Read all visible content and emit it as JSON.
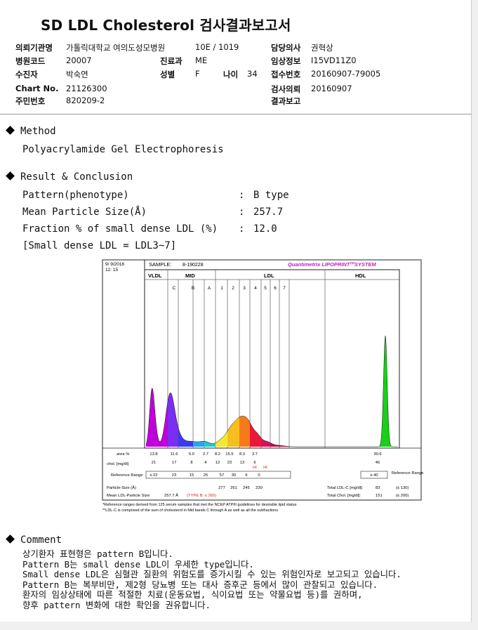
{
  "title": "SD LDL Cholesterol 검사결과보고서",
  "header": {
    "institution_label": "의뢰기관명",
    "institution_value": "가톨릭대학교 여의도성모병원",
    "ward_value": "10E / 1019",
    "doctor_label": "담당의사",
    "doctor_value": "권혁상",
    "hospital_code_label": "병원코드",
    "hospital_code_value": "20007",
    "dept_label": "진료과",
    "dept_value": "ME",
    "clinical_info_label": "임상정보",
    "clinical_info_value": "I15VD11Z0",
    "patient_label": "수진자",
    "patient_value": "박숙연",
    "sex_label": "성별",
    "sex_value": "F",
    "age_label": "나이",
    "age_value": "34",
    "receipt_label": "접수번호",
    "receipt_value": "20160907-79005",
    "chart_label": "Chart No.",
    "chart_value": "21126300",
    "request_label": "검사의뢰",
    "request_value": "20160907",
    "id_label": "주민번호",
    "id_value": "820209-2",
    "report_label": "결과보고",
    "report_value": ""
  },
  "method": {
    "heading": "Method",
    "text": "Polyacrylamide Gel Electrophoresis"
  },
  "result": {
    "heading": "Result & Conclusion",
    "rows": [
      {
        "label": "Pattern(phenotype)",
        "colon": ":",
        "value": "B type"
      },
      {
        "label": "Mean Particle Size(Å)",
        "colon": ":",
        "value": "257.7"
      },
      {
        "label": "Fraction % of small dense LDL (%)",
        "colon": ":",
        "value": "12.0"
      }
    ],
    "note": "[Small dense LDL = LDL3~7]"
  },
  "chart_data": {
    "type": "area",
    "date": "9/ 9/2016",
    "time": "12: 15",
    "sample_label": "SAMPLE:",
    "sample_value": "8-190228",
    "brand": "Quantimetrix LIPOPRINT",
    "brand_tm": "TM",
    "brand_tail": "SYSTEM",
    "groups": [
      "VLDL",
      "MID",
      "LDL",
      "HDL"
    ],
    "bands": [
      "C",
      "B",
      "A",
      "1",
      "2",
      "3",
      "4",
      "5",
      "6",
      "7"
    ],
    "band_colors": {
      "VLDL": "#c000d8",
      "C": "#7a2ef0",
      "B": "#3a3af0",
      "A": "#2aa6ee",
      "1": "#f2e830",
      "2": "#f7be20",
      "3": "#f77a1a",
      "4": "#e81a38",
      "5": "#d81060",
      "6": "#c40a4a",
      "7": "#b0103a",
      "HDL": "#18d018"
    },
    "table": {
      "area_label": "area %",
      "area": [
        "13.8",
        "11.6",
        "5.0",
        "2.7",
        "8.2",
        "15.5",
        "8.3",
        "3.7",
        "",
        "",
        "30.6"
      ],
      "chol_label": "chol. [mg/dl]",
      "chol": [
        "21",
        "17",
        "8",
        "4",
        "12",
        "23",
        "13",
        "6",
        "",
        "",
        "46"
      ],
      "hi_flags": [
        "HI",
        "HI"
      ],
      "reference_label": "Reference Range",
      "reference": [
        "≤ 22",
        "23",
        "15",
        "25",
        "57",
        "30",
        "6",
        "0"
      ],
      "hdl_reference": "≥ 40",
      "reference_range_label": "Reference Range",
      "particle_size_label": "Particle-Size (Å)",
      "particle_size": [
        "277",
        "261",
        "245",
        "230"
      ],
      "mean_size_label": "Mean LDL-Particle Size:",
      "mean_size_value": "257.7 Å",
      "type_b_note": "(TYPE B: ≤ 265)",
      "total_ldl_label": "Total LDL-C [mg/dl]:",
      "total_ldl_value": "83",
      "total_ldl_ref": "(≤ 130)",
      "total_chol_label": "Total Chol. [mg/dl]:",
      "total_chol_value": "151",
      "total_chol_ref": "(≤ 200)"
    },
    "footnotes": [
      "*Reference ranges derived from 125 serum samples that met the NCEP ATPIII guidelines for desirable lipid status",
      "**LDL-C is comprised of the sum of cholesterol in Mid bands C through A as well as all the subfractions"
    ]
  },
  "comment": {
    "heading": "Comment",
    "lines": [
      "상기환자 표현형은 pattern B입니다.",
      "Pattern B는 small dense LDL이 우세한 type입니다.",
      "Small dense LDL은 심혈관 질환의 위험도를 증가시킬 수 있는 위험인자로 보고되고 있습니다.",
      "Pattern B는 복부비만, 제2형 당뇨병 또는 대사 증후군 등에서 많이 관찰되고 있습니다.",
      "환자의 임상상태에 따른 적절한 치료(운동요법, 식이요법 또는 약물요법 등)를 권하며,",
      "향후 pattern 변화에 대한 확인을 권유합니다."
    ]
  }
}
